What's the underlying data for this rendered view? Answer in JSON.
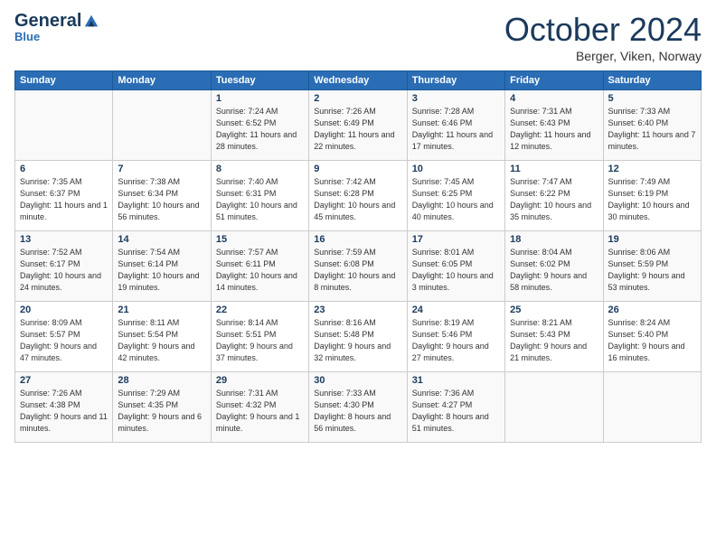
{
  "header": {
    "logo_general": "General",
    "logo_blue": "Blue",
    "month_title": "October 2024",
    "location": "Berger, Viken, Norway"
  },
  "days_of_week": [
    "Sunday",
    "Monday",
    "Tuesday",
    "Wednesday",
    "Thursday",
    "Friday",
    "Saturday"
  ],
  "weeks": [
    [
      {
        "day": "",
        "info": ""
      },
      {
        "day": "",
        "info": ""
      },
      {
        "day": "1",
        "info": "Sunrise: 7:24 AM\nSunset: 6:52 PM\nDaylight: 11 hours and 28 minutes."
      },
      {
        "day": "2",
        "info": "Sunrise: 7:26 AM\nSunset: 6:49 PM\nDaylight: 11 hours and 22 minutes."
      },
      {
        "day": "3",
        "info": "Sunrise: 7:28 AM\nSunset: 6:46 PM\nDaylight: 11 hours and 17 minutes."
      },
      {
        "day": "4",
        "info": "Sunrise: 7:31 AM\nSunset: 6:43 PM\nDaylight: 11 hours and 12 minutes."
      },
      {
        "day": "5",
        "info": "Sunrise: 7:33 AM\nSunset: 6:40 PM\nDaylight: 11 hours and 7 minutes."
      }
    ],
    [
      {
        "day": "6",
        "info": "Sunrise: 7:35 AM\nSunset: 6:37 PM\nDaylight: 11 hours and 1 minute."
      },
      {
        "day": "7",
        "info": "Sunrise: 7:38 AM\nSunset: 6:34 PM\nDaylight: 10 hours and 56 minutes."
      },
      {
        "day": "8",
        "info": "Sunrise: 7:40 AM\nSunset: 6:31 PM\nDaylight: 10 hours and 51 minutes."
      },
      {
        "day": "9",
        "info": "Sunrise: 7:42 AM\nSunset: 6:28 PM\nDaylight: 10 hours and 45 minutes."
      },
      {
        "day": "10",
        "info": "Sunrise: 7:45 AM\nSunset: 6:25 PM\nDaylight: 10 hours and 40 minutes."
      },
      {
        "day": "11",
        "info": "Sunrise: 7:47 AM\nSunset: 6:22 PM\nDaylight: 10 hours and 35 minutes."
      },
      {
        "day": "12",
        "info": "Sunrise: 7:49 AM\nSunset: 6:19 PM\nDaylight: 10 hours and 30 minutes."
      }
    ],
    [
      {
        "day": "13",
        "info": "Sunrise: 7:52 AM\nSunset: 6:17 PM\nDaylight: 10 hours and 24 minutes."
      },
      {
        "day": "14",
        "info": "Sunrise: 7:54 AM\nSunset: 6:14 PM\nDaylight: 10 hours and 19 minutes."
      },
      {
        "day": "15",
        "info": "Sunrise: 7:57 AM\nSunset: 6:11 PM\nDaylight: 10 hours and 14 minutes."
      },
      {
        "day": "16",
        "info": "Sunrise: 7:59 AM\nSunset: 6:08 PM\nDaylight: 10 hours and 8 minutes."
      },
      {
        "day": "17",
        "info": "Sunrise: 8:01 AM\nSunset: 6:05 PM\nDaylight: 10 hours and 3 minutes."
      },
      {
        "day": "18",
        "info": "Sunrise: 8:04 AM\nSunset: 6:02 PM\nDaylight: 9 hours and 58 minutes."
      },
      {
        "day": "19",
        "info": "Sunrise: 8:06 AM\nSunset: 5:59 PM\nDaylight: 9 hours and 53 minutes."
      }
    ],
    [
      {
        "day": "20",
        "info": "Sunrise: 8:09 AM\nSunset: 5:57 PM\nDaylight: 9 hours and 47 minutes."
      },
      {
        "day": "21",
        "info": "Sunrise: 8:11 AM\nSunset: 5:54 PM\nDaylight: 9 hours and 42 minutes."
      },
      {
        "day": "22",
        "info": "Sunrise: 8:14 AM\nSunset: 5:51 PM\nDaylight: 9 hours and 37 minutes."
      },
      {
        "day": "23",
        "info": "Sunrise: 8:16 AM\nSunset: 5:48 PM\nDaylight: 9 hours and 32 minutes."
      },
      {
        "day": "24",
        "info": "Sunrise: 8:19 AM\nSunset: 5:46 PM\nDaylight: 9 hours and 27 minutes."
      },
      {
        "day": "25",
        "info": "Sunrise: 8:21 AM\nSunset: 5:43 PM\nDaylight: 9 hours and 21 minutes."
      },
      {
        "day": "26",
        "info": "Sunrise: 8:24 AM\nSunset: 5:40 PM\nDaylight: 9 hours and 16 minutes."
      }
    ],
    [
      {
        "day": "27",
        "info": "Sunrise: 7:26 AM\nSunset: 4:38 PM\nDaylight: 9 hours and 11 minutes."
      },
      {
        "day": "28",
        "info": "Sunrise: 7:29 AM\nSunset: 4:35 PM\nDaylight: 9 hours and 6 minutes."
      },
      {
        "day": "29",
        "info": "Sunrise: 7:31 AM\nSunset: 4:32 PM\nDaylight: 9 hours and 1 minute."
      },
      {
        "day": "30",
        "info": "Sunrise: 7:33 AM\nSunset: 4:30 PM\nDaylight: 8 hours and 56 minutes."
      },
      {
        "day": "31",
        "info": "Sunrise: 7:36 AM\nSunset: 4:27 PM\nDaylight: 8 hours and 51 minutes."
      },
      {
        "day": "",
        "info": ""
      },
      {
        "day": "",
        "info": ""
      }
    ]
  ]
}
